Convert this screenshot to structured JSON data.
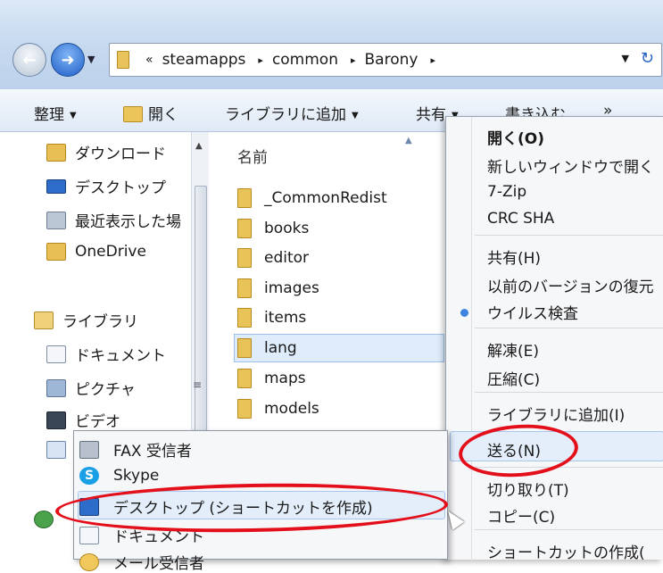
{
  "address": {
    "overflow": "«",
    "crumbs": [
      "steamapps",
      "common",
      "Barony"
    ]
  },
  "toolbar": {
    "organize": "整理",
    "open": "開く",
    "add_to_library": "ライブラリに追加",
    "share": "共有",
    "burn": "書き込む",
    "more": "»"
  },
  "nav": {
    "items": [
      "ダウンロード",
      "デスクトップ",
      "最近表示した場",
      "OneDrive",
      "ライブラリ",
      "ドキュメント",
      "ピクチャ",
      "ビデオ"
    ]
  },
  "content": {
    "column_name": "名前",
    "files": [
      "_CommonRedist",
      "books",
      "editor",
      "images",
      "items",
      "lang",
      "maps",
      "models"
    ],
    "selected": "lang"
  },
  "context_menu": {
    "items": [
      "開く(O)",
      "新しいウィンドウで開く",
      "7-Zip",
      "CRC SHA",
      "共有(H)",
      "以前のバージョンの復元",
      "ウイルス検査",
      "解凍(E)",
      "圧縮(C)",
      "ライブラリに追加(I)",
      "送る(N)",
      "切り取り(T)",
      "コピー(C)",
      "ショートカットの作成("
    ]
  },
  "send_to": {
    "items": [
      "FAX 受信者",
      "Skype",
      "デスクトップ (ショートカットを作成)",
      "ドキュメント",
      "メール受信者"
    ]
  },
  "icons": {
    "skype": "S",
    "fwd_arrow": "➜",
    "back_arrow": "←",
    "refresh": "↻",
    "dropdown": "▼",
    "sep": "▸",
    "grip": "≡"
  },
  "colors": {
    "annotation": "#e3101c",
    "highlight": "#e4eefb"
  }
}
